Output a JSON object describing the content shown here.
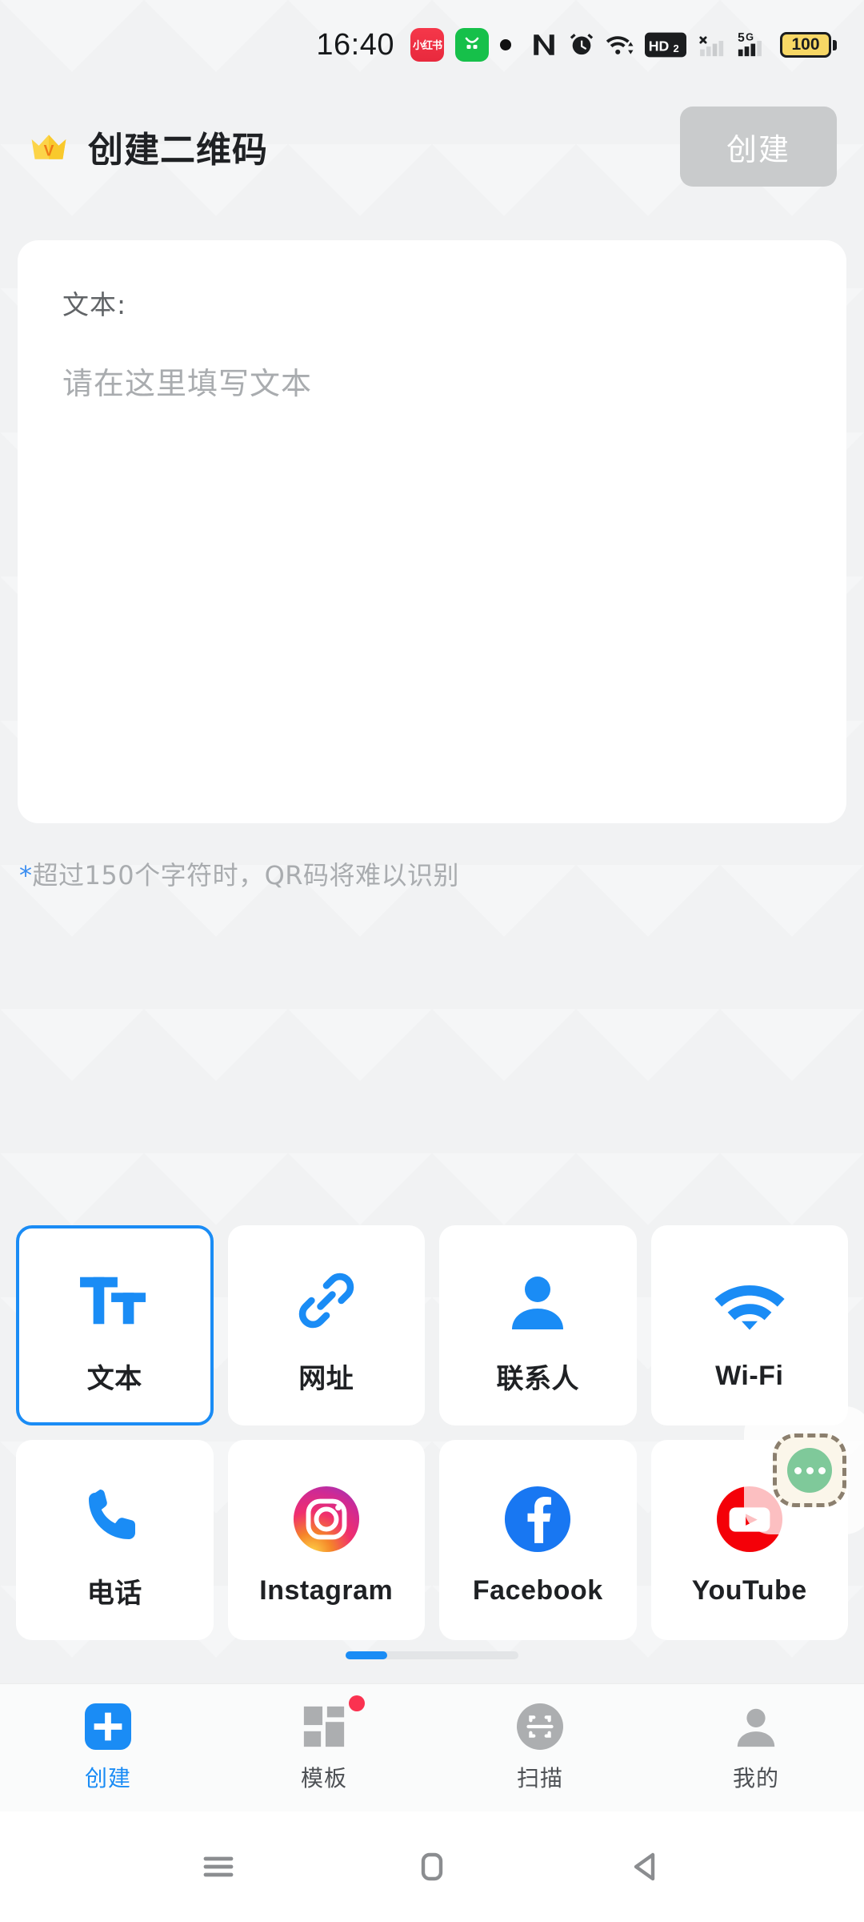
{
  "status_bar": {
    "clock": "16:40",
    "app_badges": [
      {
        "name": "xiaohongshu-app-icon",
        "label": "小红书"
      },
      {
        "name": "app-icon-green",
        "label": ""
      }
    ],
    "dot_indicator": "•",
    "icons": [
      "nfc-icon",
      "alarm-icon",
      "wifi-icon",
      "hd2-icon",
      "signal-no-service-icon",
      "5g-signal-icon",
      "battery-icon"
    ],
    "hd_label": "HD",
    "hd_sub": "2",
    "network_label": "5G",
    "battery_level": "100"
  },
  "header": {
    "vip_icon": "crown-icon",
    "title": "创建二维码",
    "create_label": "创建"
  },
  "input_card": {
    "label": "文本:",
    "placeholder": "请在这里填写文本",
    "value": ""
  },
  "hint": {
    "star": "*",
    "text": "超过150个字符时，QR码将难以识别"
  },
  "types": [
    {
      "label": "文本",
      "icon": "text-format-icon",
      "selected": true,
      "cn": true
    },
    {
      "label": "网址",
      "icon": "link-icon",
      "selected": false,
      "cn": true
    },
    {
      "label": "联系人",
      "icon": "person-icon",
      "selected": false,
      "cn": true
    },
    {
      "label": "Wi-Fi",
      "icon": "wifi-icon",
      "selected": false,
      "cn": false
    },
    {
      "label": "电话",
      "icon": "phone-icon",
      "selected": false,
      "cn": true
    },
    {
      "label": "Instagram",
      "icon": "instagram-icon",
      "selected": false,
      "cn": false
    },
    {
      "label": "Facebook",
      "icon": "facebook-icon",
      "selected": false,
      "cn": false
    },
    {
      "label": "YouTube",
      "icon": "youtube-icon",
      "selected": false,
      "cn": false
    }
  ],
  "page_indicator": {
    "pages": 4,
    "current": 1
  },
  "bottom_nav": [
    {
      "label": "创建",
      "icon": "plus-square-icon",
      "active": true,
      "badge": false
    },
    {
      "label": "模板",
      "icon": "grid-icon",
      "active": false,
      "badge": true
    },
    {
      "label": "扫描",
      "icon": "scan-icon",
      "active": false,
      "badge": false
    },
    {
      "label": "我的",
      "icon": "person-icon",
      "active": false,
      "badge": false
    }
  ],
  "android_nav": [
    {
      "name": "recents-button",
      "icon": "menu-icon"
    },
    {
      "name": "home-button",
      "icon": "home-square-icon"
    },
    {
      "name": "back-button",
      "icon": "back-triangle-icon"
    }
  ],
  "assistant": {
    "icon": "three-dots-icon"
  },
  "colors": {
    "accent": "#1a8cf5",
    "bg": "#f1f2f3",
    "card": "#ffffff",
    "muted": "#a9acaf",
    "badge": "#fa3250",
    "battery": "#f7d765"
  }
}
